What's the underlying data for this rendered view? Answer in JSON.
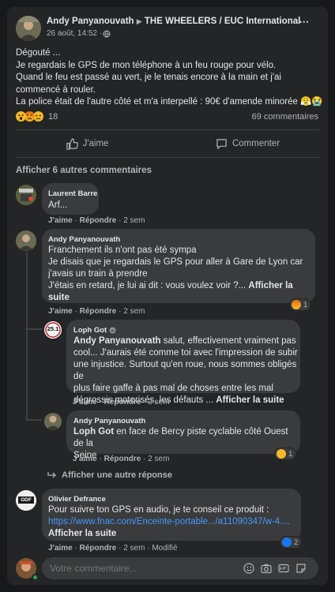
{
  "post": {
    "author": "Andy Panyanouvath",
    "arrow": "▶",
    "group": "THE WHEELERS / EUC International",
    "date": "26 août, 14:52 · ",
    "more": "•••",
    "lines": [
      "Dégouté ...",
      "Je regardais le GPS de mon téléphone à un feu rouge pour vélo.",
      "Quand le feu est passé au vert, je le tenais encore à la main et j'ai commencé à rouler.",
      "La police était de l'autre côté et m'a interpellé : 90€ d'amende minorée 😤😭"
    ],
    "reaction_count": "18",
    "comments_count": "69 commentaires"
  },
  "actions": {
    "like": "J'aime",
    "comment": "Commenter"
  },
  "show_more_comments": "Afficher 6 autres commentaires",
  "comments": [
    {
      "name": "Laurent Barre",
      "text": "Arf...",
      "like": "J'aime",
      "reply": "Répondre",
      "time": "2 sem"
    },
    {
      "name": "Andy Panyanouvath",
      "text1": "Franchement ils n'ont pas été sympa",
      "text2": "Je disais que je regardais le GPS pour aller à Gare de Lyon car",
      "text3": "j'avais un train à prendre",
      "text4": "J'étais en retard, je lui ai dit : vous voulez voir ?...",
      "see_more": "Afficher la suite",
      "like": "J'aime",
      "reply": "Répondre",
      "time": "2 sem",
      "reaction_count": "1"
    },
    {
      "name": "Loph Got",
      "mention": "Andy Panyanouvath",
      "text1": " salut, effectivement vraiment pas",
      "text2": "cool... J'aurais été comme toi avec l'impression de subir",
      "text3": "une injustice. Surtout qu'en roue, nous sommes obligés de",
      "text4": "plus faire gaffe à pas mal de choses entre les mal",
      "text5": "dégrossis motorisés, les défauts ...",
      "see_more": "Afficher la suite",
      "like": "J'aime",
      "reply": "Répondre",
      "time": "2 sem",
      "avatar_text": "25.1"
    },
    {
      "name": "Andy Panyanouvath",
      "mention": "Loph Got",
      "text1": " en face de Bercy piste cyclable côté Ouest de la",
      "text2": "Seine",
      "like": "J'aime",
      "reply": "Répondre",
      "time": "2 sem",
      "reaction_count": "1"
    },
    {
      "name": "Olivier Defrance",
      "text1": "Pour suivre ton GPS en audio, je te conseil ce produit :",
      "link": "https://www.fnac.com/Enceinte-portable.../a11090347/w-4....",
      "see_more": "Afficher la suite",
      "like": "J'aime",
      "reply": "Répondre",
      "time": "2 sem",
      "modified": "Modifié",
      "reaction_count": "2",
      "avatar_text": "ODF"
    }
  ],
  "show_other_reply": "Afficher une autre réponse",
  "composer": {
    "placeholder": "Votre commentaire..."
  },
  "colors": {
    "link": "#4599ff",
    "background": "#242526",
    "bubble": "#3a3b3c"
  }
}
